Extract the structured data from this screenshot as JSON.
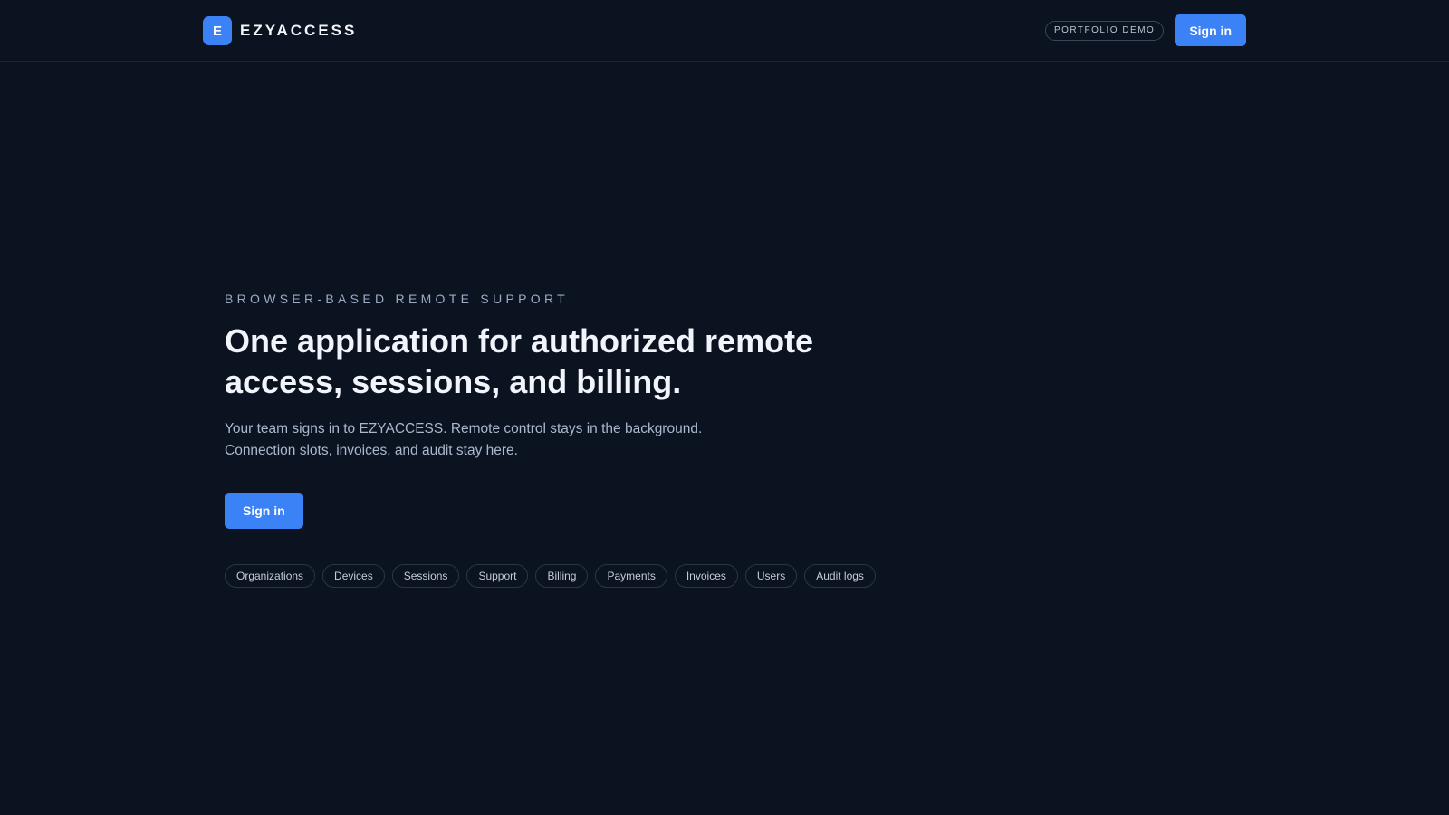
{
  "brand": {
    "mark": "E",
    "name": "EZYACCESS",
    "accent_color": "#3b82f6"
  },
  "header": {
    "badge": "PORTFOLIO DEMO",
    "sign_in_label": "Sign in"
  },
  "hero": {
    "eyebrow": "BROWSER-BASED REMOTE SUPPORT",
    "headline_line1": "One application for authorized remote",
    "headline_line2": "access, sessions, and billing.",
    "subtext_line1": "Your team signs in to EZYACCESS. Remote control stays in the background.",
    "subtext_line2": "Connection slots, invoices, and audit stay here.",
    "cta_label": "Sign in"
  },
  "chips": [
    "Organizations",
    "Devices",
    "Sessions",
    "Support",
    "Billing",
    "Payments",
    "Invoices",
    "Users",
    "Audit logs"
  ],
  "colors": {
    "background": "#0b1220",
    "primary": "#3b82f6",
    "muted_text": "#a9b8cc"
  }
}
